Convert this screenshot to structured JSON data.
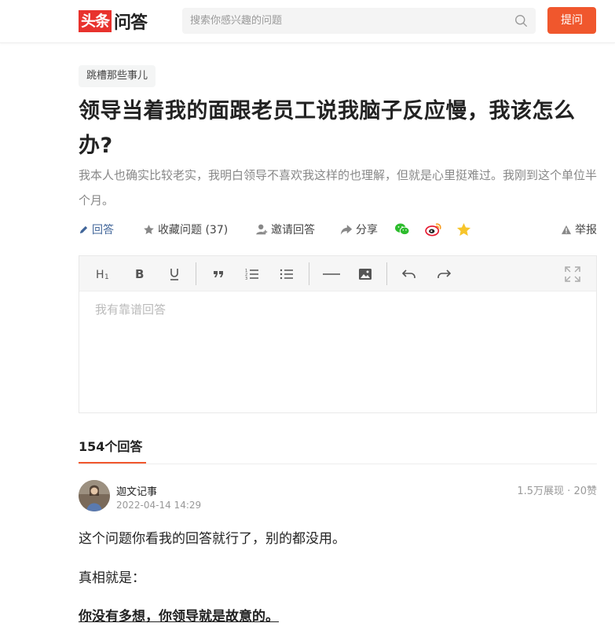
{
  "header": {
    "logo_red": "头条",
    "logo_black": "问答",
    "search_placeholder": "搜索你感兴趣的问题",
    "ask_button": "提问"
  },
  "question": {
    "tag": "跳槽那些事儿",
    "title": "领导当着我的面跟老员工说我脑子反应慢，我该怎么办?",
    "description": "我本人也确实比较老实，我明白领导不喜欢我这样的也理解，但就是心里挺难过。我刚到这个单位半个月。"
  },
  "actions": {
    "answer": "回答",
    "collect": "收藏问题 (37)",
    "invite": "邀请回答",
    "share": "分享",
    "report": "举报"
  },
  "editor": {
    "placeholder": "我有靠谱回答",
    "toolbar": [
      "heading-icon",
      "bold-icon",
      "underline-icon",
      "quote-icon",
      "ordered-list-icon",
      "bullet-list-icon",
      "divider-icon",
      "image-icon",
      "undo-icon",
      "redo-icon",
      "fullscreen-icon"
    ]
  },
  "answers": {
    "count_label": "154个回答",
    "items": [
      {
        "author": "迦文记事",
        "date": "2022-04-14 14:29",
        "stats": "1.5万展现 · 20赞",
        "paragraphs": [
          "这个问题你看我的回答就行了，别的都没用。",
          "真相就是：",
          "你没有多想，你领导就是故意的。"
        ]
      }
    ]
  },
  "colors": {
    "accent": "#f0572d",
    "logo_red": "#e8322d",
    "link_blue": "#406599"
  }
}
